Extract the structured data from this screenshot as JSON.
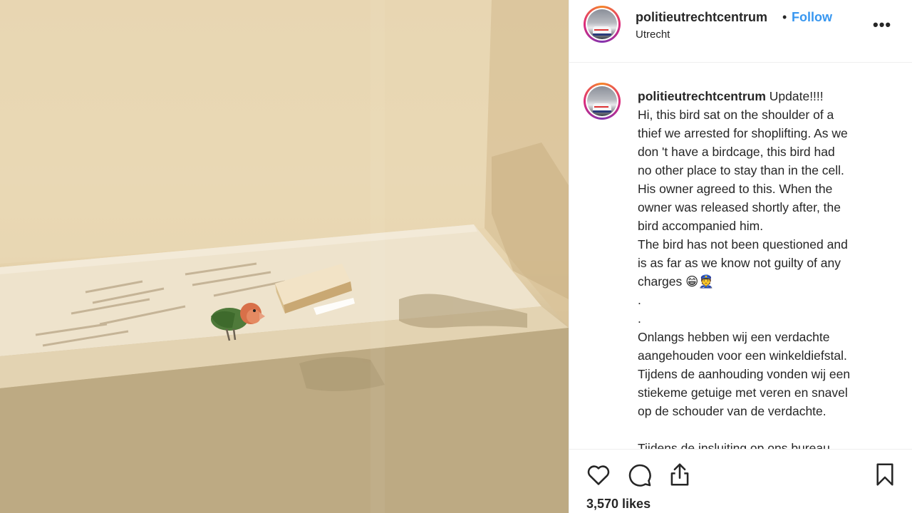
{
  "post": {
    "username": "politieutrechtcentrum",
    "separator": "•",
    "follow_label": "Follow",
    "location": "Utrecht",
    "more_label": "•••",
    "caption": {
      "username": "politieutrechtcentrum",
      "first": "Update!!!!",
      "lines": [
        "Hi, this bird sat on the shoulder of a",
        "thief we arrested for shoplifting. As we",
        "don 't have a birdcage, this bird had",
        "no other place to stay than in the cell.",
        "His owner agreed to this. When the",
        "owner was released shortly after, the",
        "bird accompanied him.",
        "The bird has not been questioned and",
        "is as far as we know not guilty of any",
        "charges 😁👮",
        ".",
        ".",
        "Onlangs hebben wij een verdachte",
        "aangehouden voor een winkeldiefstal.",
        "Tijdens de aanhouding vonden wij een",
        "stiekeme getuige met veren en snavel",
        "op de schouder van de verdachte.",
        "",
        "Tijdens de insluiting op ons bureau"
      ]
    },
    "likes": "3,570 likes"
  },
  "icons": {
    "like": "heart-icon",
    "comment": "comment-icon",
    "share": "share-icon",
    "save": "bookmark-icon"
  }
}
